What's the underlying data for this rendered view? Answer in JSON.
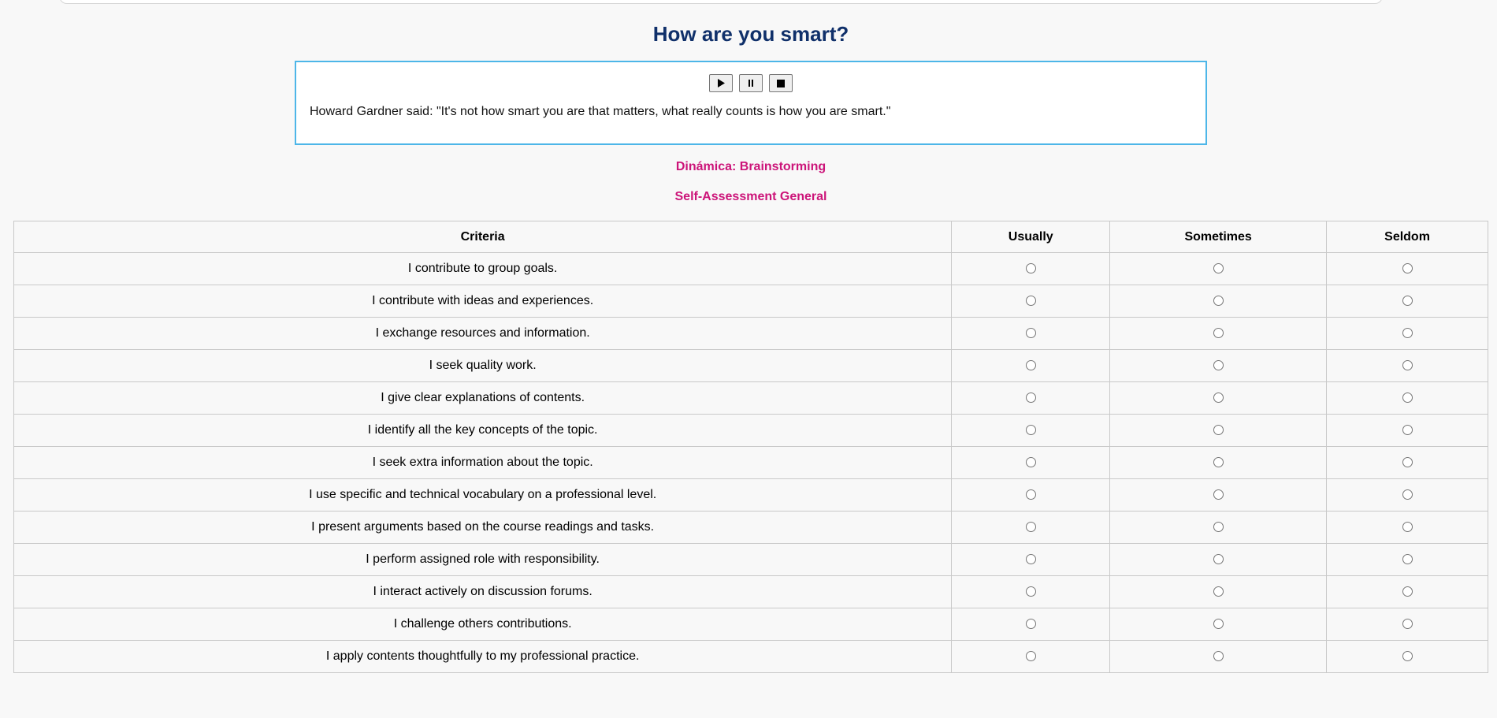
{
  "page": {
    "title": "How are you smart?"
  },
  "audio": {
    "play_icon": "play-icon",
    "pause_icon": "pause-icon",
    "stop_icon": "stop-icon",
    "quote": "Howard Gardner said: \"It's not how smart you are that matters, what really counts is how you are smart.\""
  },
  "dinamica": "Dinámica: Brainstorming",
  "assessment_title": "Self-Assessment General",
  "table": {
    "headers": [
      "Criteria",
      "Usually",
      "Sometimes",
      "Seldom"
    ],
    "rows": [
      "I contribute to group goals.",
      "I contribute with ideas and experiences.",
      "I exchange resources and information.",
      "I seek quality work.",
      "I give clear explanations of contents.",
      "I identify all the key concepts of the topic.",
      "I seek extra information about the topic.",
      "I use specific and technical vocabulary on a professional level.",
      "I present arguments based on the course readings and tasks.",
      "I perform assigned role with responsibility.",
      "I interact actively on discussion forums.",
      "I challenge others contributions.",
      "I apply contents thoughtfully to my professional practice."
    ]
  },
  "colors": {
    "title": "#10306a",
    "accent": "#cc1479",
    "audio_border": "#4db6e8"
  }
}
